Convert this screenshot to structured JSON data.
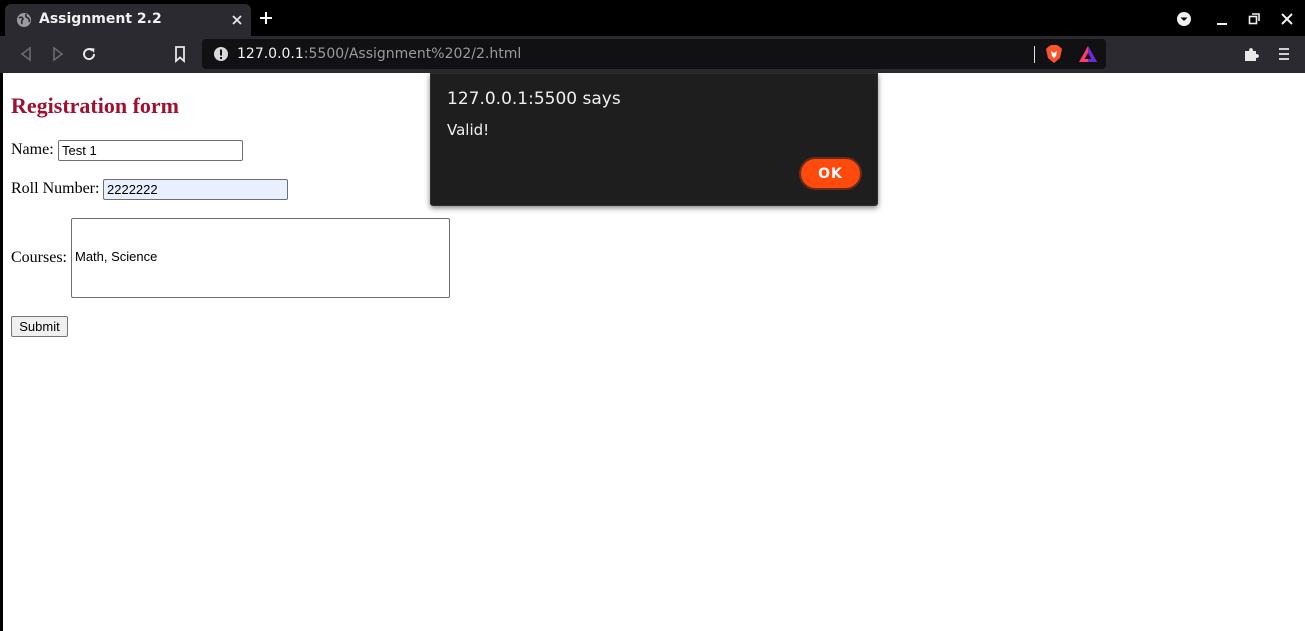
{
  "browser": {
    "tab": {
      "title": "Assignment 2.2"
    },
    "address": {
      "host": "127.0.0.1",
      "rest": ":5500/Assignment%202/2.html"
    }
  },
  "form": {
    "title": "Registration form",
    "name_label": "Name:",
    "name_value": "Test 1",
    "roll_label": "Roll Number:",
    "roll_value": "2222222",
    "courses_label": "Courses:",
    "courses_value": "Math, Science",
    "submit_label": "Submit"
  },
  "dialog": {
    "title": "127.0.0.1:5500 says",
    "message": "Valid!",
    "ok_label": "OK"
  },
  "colors": {
    "form_title": "#a01030",
    "ok_button": "#ff4a0e",
    "autofill_bg": "#e8f0fe"
  },
  "icons": {
    "tab_favicon": "globe-icon",
    "tab_close": "close-icon",
    "new_tab": "plus-icon",
    "profile": "chevron-down-circle-icon",
    "minimize": "minimize-icon",
    "restore": "restore-icon",
    "close_window": "close-icon",
    "back": "back-arrow-icon",
    "forward": "forward-arrow-icon",
    "reload": "reload-icon",
    "bookmark": "bookmark-icon",
    "site_info": "info-icon",
    "shields": "brave-shield-icon",
    "rewards": "brave-rewards-icon",
    "extensions": "puzzle-icon",
    "menu": "hamburger-menu-icon"
  }
}
